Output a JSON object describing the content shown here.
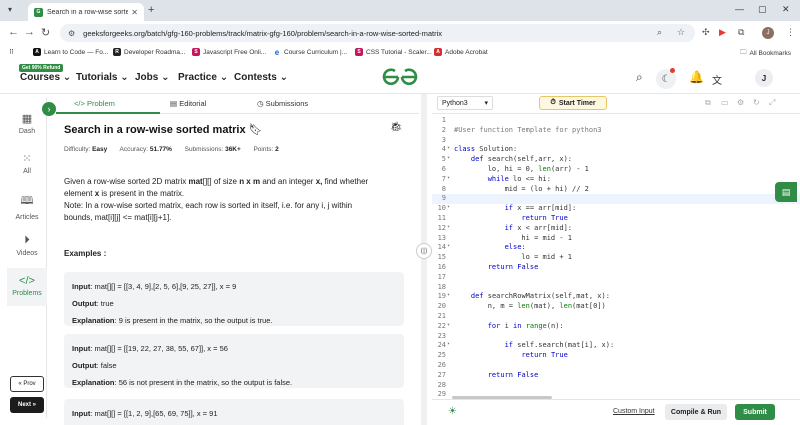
{
  "browser": {
    "tab_title": "Search in a row-wise sorted ma",
    "url": "geeksforgeeks.org/batch/gfg-160-problems/track/matrix-gfg-160/problem/search-in-a-row-wise-sorted-matrix",
    "profile_initial": "J",
    "bookmarks": [
      {
        "label": "Learn to Code — Fo...",
        "color": "#111111",
        "glyph": "A"
      },
      {
        "label": "Developer Roadma...",
        "color": "#222222",
        "glyph": "R"
      },
      {
        "label": "Javascript Free Onli...",
        "color": "#c2185b",
        "glyph": "S"
      },
      {
        "label": "Course Curriculum |...",
        "color": "#1565c0",
        "glyph": "e"
      },
      {
        "label": "CSS Tutorial - Scaler...",
        "color": "#c2185b",
        "glyph": "S"
      },
      {
        "label": "Adobe Acrobat",
        "color": "#d32f2f",
        "glyph": "A"
      }
    ],
    "all_bookmarks": "All Bookmarks"
  },
  "nav": {
    "refund_badge": "Get 90% Refund",
    "items": [
      "Courses",
      "Tutorials",
      "Jobs",
      "Practice",
      "Contests"
    ],
    "avatar": "J"
  },
  "sidebar": {
    "items": [
      "Dash",
      "All",
      "Articles",
      "Videos",
      "Problems"
    ],
    "prev": "« Prov",
    "next": "Next »"
  },
  "problem": {
    "tabs": [
      "Problem",
      "Editorial",
      "Submissions"
    ],
    "title": "Search in a row-wise sorted matrix",
    "difficulty_label": "Difficulty:",
    "difficulty": "Easy",
    "accuracy_label": "Accuracy:",
    "accuracy": "51.77%",
    "submissions_label": "Submissions:",
    "submissions": "36K+",
    "points_label": "Points:",
    "points": "2",
    "desc_1": "Given a row-wise sorted 2D matrix ",
    "desc_1b": "mat",
    "desc_1c": "[][] of size ",
    "desc_1d": "n x m",
    "desc_1e": " and an integer ",
    "desc_1f": "x,",
    "desc_1g": " find whether",
    "desc_2": "element ",
    "desc_2b": "x",
    "desc_2c": " is present in the matrix.",
    "desc_3": "Note: In a row-wise sorted matrix, each row is sorted in itself, i.e. for any i, j within",
    "desc_4": "bounds, mat[i][j] <= mat[i][j+1].",
    "examples_heading": "Examples :",
    "examples": [
      {
        "input": "mat[][] = [[3, 4, 9],[2, 5, 6],[9, 25, 27]], x = 9",
        "output": "true",
        "explanation": "9 is present in the matrix, so the output is true."
      },
      {
        "input": "mat[][] = [[19, 22, 27, 38, 55, 67]], x = 56",
        "output": "false",
        "explanation": "56 is not present in the matrix, so the output is false."
      },
      {
        "input": "mat[][] = [[1, 2, 9],[65, 69, 75]], x = 91",
        "output": "",
        "explanation": ""
      }
    ],
    "input_label": "Input",
    "output_label": "Output",
    "explanation_label": "Explanation"
  },
  "editor": {
    "language": "Python3",
    "timer": "Start Timer",
    "custom_input": "Custom Input",
    "compile_run": "Compile & Run",
    "submit": "Submit",
    "lines": [
      "",
      "#User function Template for python3",
      "",
      "class Solution:",
      "    def search(self,arr, x):",
      "        lo, hi = 0, len(arr) - 1",
      "        while lo <= hi:",
      "            mid = (lo + hi) // 2",
      "",
      "            if x == arr[mid]:",
      "                return True",
      "            if x < arr[mid]:",
      "                hi = mid - 1",
      "            else:",
      "                lo = mid + 1",
      "        return False",
      "",
      "",
      "    def searchRowMatrix(self,mat, x):",
      "        n, m = len(mat), len(mat[0])",
      "",
      "        for i in range(n):",
      "",
      "            if self.search(mat[i], x):",
      "                return True",
      "",
      "        return False",
      "",
      ""
    ]
  }
}
